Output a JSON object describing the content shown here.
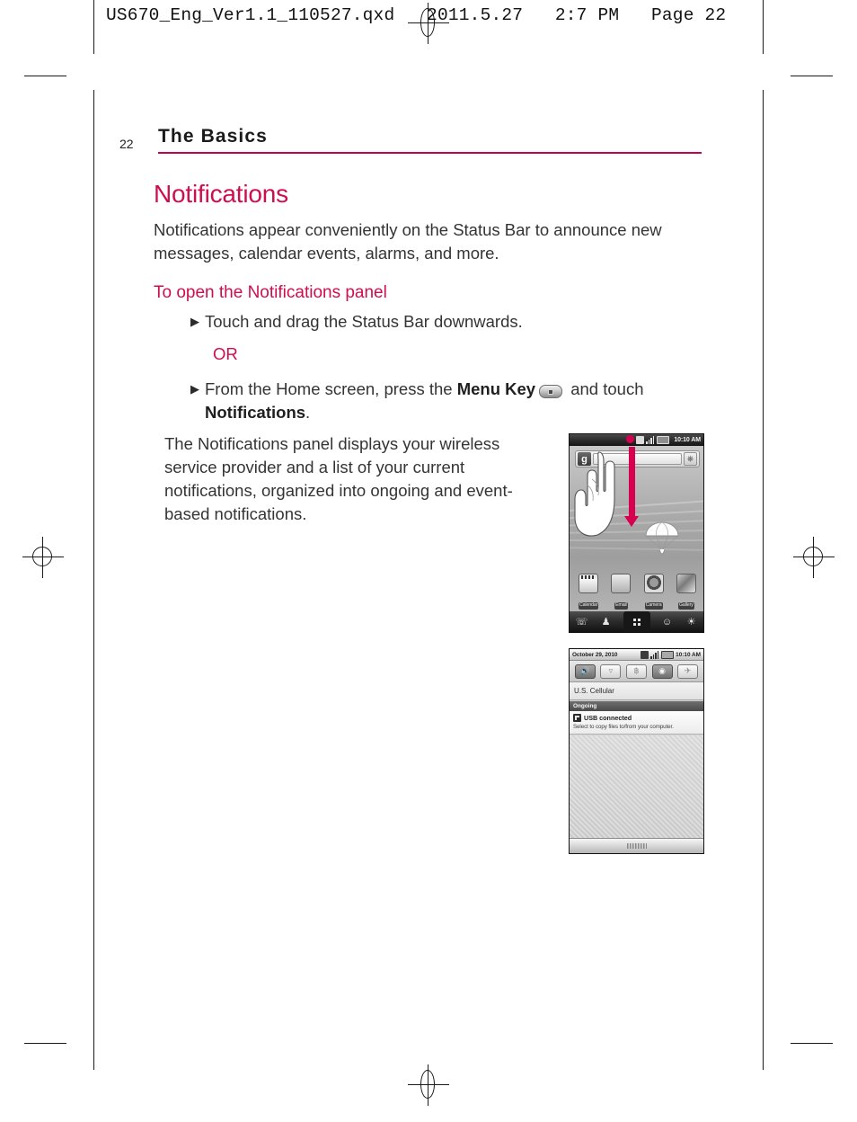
{
  "print_header": {
    "file_info": "US670_Eng_Ver1.1_110527.qxd   2011.5.27   2:7 PM   Page 22"
  },
  "page": {
    "number": "22",
    "chapter_title": "The Basics",
    "accent_color": "#ce0e4e"
  },
  "content": {
    "section_title": "Notifications",
    "intro_paragraph": "Notifications appear conveniently on the Status Bar to announce new messages, calendar events, alarms, and more.",
    "sub_heading": "To open the Notifications panel",
    "bullet_marker": "▶",
    "bullet_1": "Touch and drag the Status Bar downwards.",
    "or_label": "OR",
    "bullet_2_part1": "From the Home screen, press the ",
    "bullet_2_strong1": "Menu Key",
    "bullet_2_part2": " and touch ",
    "bullet_2_strong2": "Notifications",
    "bullet_2_part3": ".",
    "panel_paragraph": "The Notifications panel displays your wireless service provider and a list of your current notifications, organized into ongoing and event-based notifications."
  },
  "phone_home": {
    "status_time": "10:10 AM",
    "search_logo": "g",
    "mic_glyph": "⬤",
    "apps": [
      {
        "label": "Calendar",
        "icon": "calendar-app-icon"
      },
      {
        "label": "Email",
        "icon": "email-app-icon"
      },
      {
        "label": "Camera",
        "icon": "camera-app-icon"
      },
      {
        "label": "Gallery",
        "icon": "gallery-app-icon"
      }
    ],
    "dock": [
      {
        "name": "phone-dock-icon",
        "glyph": "✆"
      },
      {
        "name": "contacts-dock-icon",
        "glyph": "♟"
      },
      {
        "name": "launcher-dock-icon",
        "glyph": "grid"
      },
      {
        "name": "messaging-dock-icon",
        "glyph": "☺"
      },
      {
        "name": "browser-dock-icon",
        "glyph": "ἱ0"
      }
    ]
  },
  "phone_notifications": {
    "date": "October 29, 2010",
    "status_time": "10:10 AM",
    "toggles": [
      {
        "name": "sound-toggle",
        "glyph": "ὐA",
        "state": "on"
      },
      {
        "name": "wifi-toggle",
        "glyph": "▽",
        "state": "off"
      },
      {
        "name": "bluetooth-toggle",
        "glyph": "฿",
        "state": "off"
      },
      {
        "name": "gps-toggle",
        "glyph": "◉",
        "state": "on"
      },
      {
        "name": "airplane-mode-toggle",
        "glyph": "✈",
        "state": "off"
      }
    ],
    "carrier": "U.S. Cellular",
    "section_label": "Ongoing",
    "notification_title": "USB connected",
    "notification_subtitle": "Select to copy files to/from your computer."
  }
}
